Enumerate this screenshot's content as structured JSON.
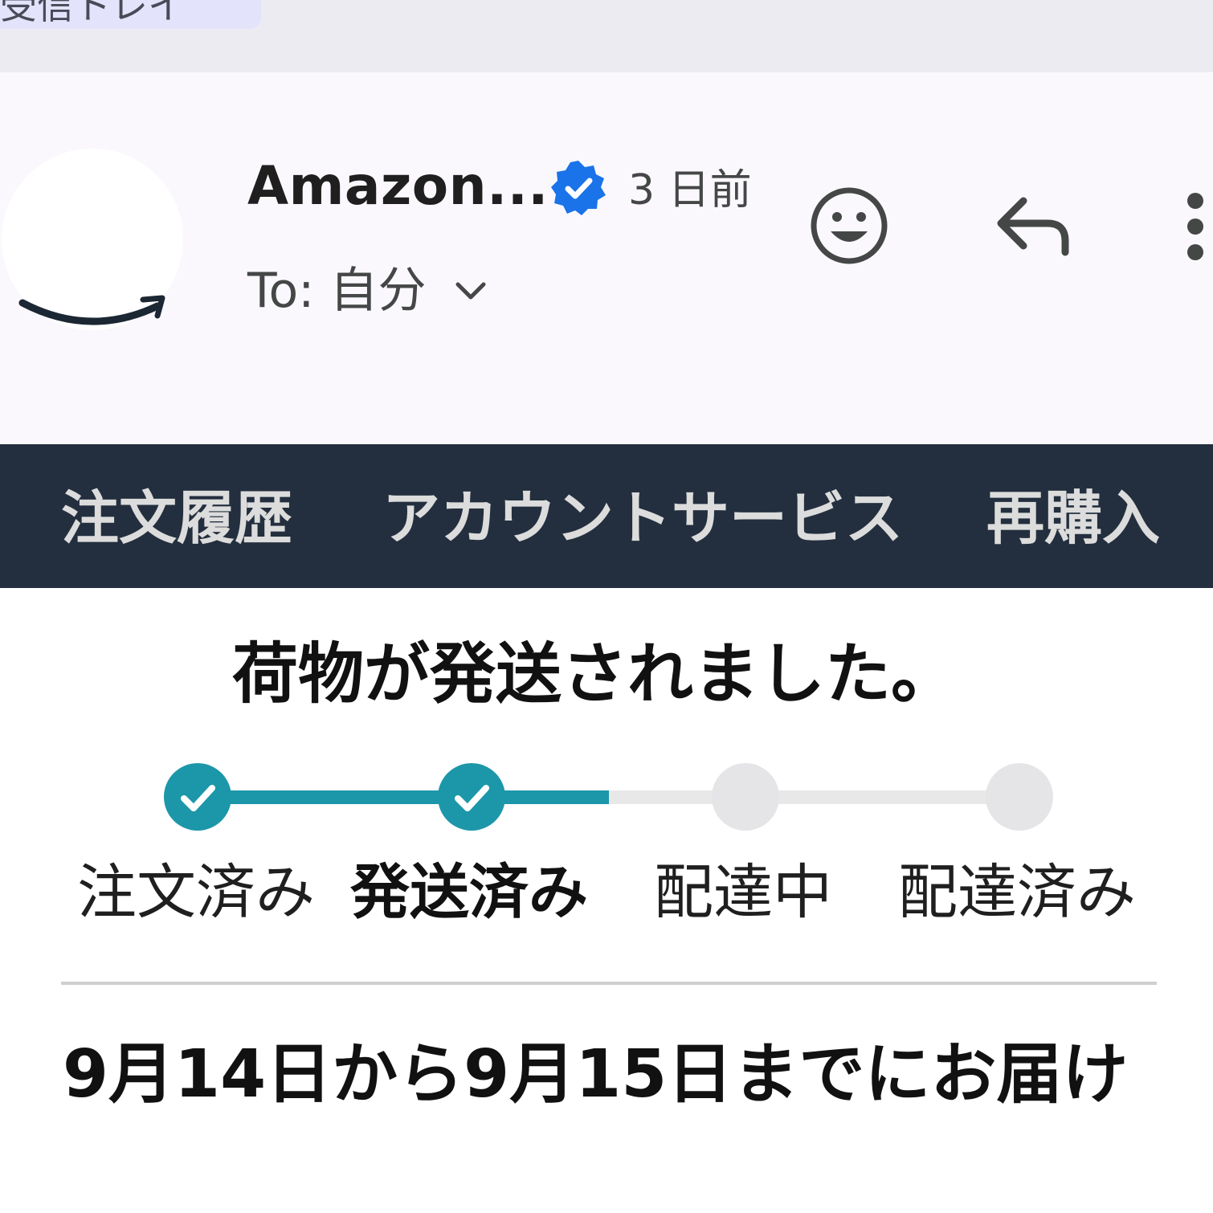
{
  "folder_chip": {
    "label": "受信トレイ"
  },
  "email": {
    "sender": "Amazon...",
    "time": "3 日前",
    "recipient": "To: 自分"
  },
  "nav": {
    "orders": "注文履歴",
    "account": "アカウントサービス",
    "rebuy": "再購入"
  },
  "content": {
    "headline": "荷物が発送されました。",
    "steps": [
      {
        "label": "注文済み",
        "state": "done"
      },
      {
        "label": "発送済み",
        "state": "current"
      },
      {
        "label": "配達中",
        "state": "pending"
      },
      {
        "label": "配達済み",
        "state": "pending"
      }
    ],
    "delivery_text": "9月14日から9月15日までにお届け"
  },
  "colors": {
    "nav_background": "#232f3e",
    "progress_accent": "#1c97a9",
    "verified_blue": "#1a73e8"
  },
  "icons": [
    "amazon-smile-logo",
    "verified-icon",
    "chevron-down-icon",
    "emoji-icon",
    "reply-icon",
    "more-vertical-icon",
    "check-icon"
  ]
}
